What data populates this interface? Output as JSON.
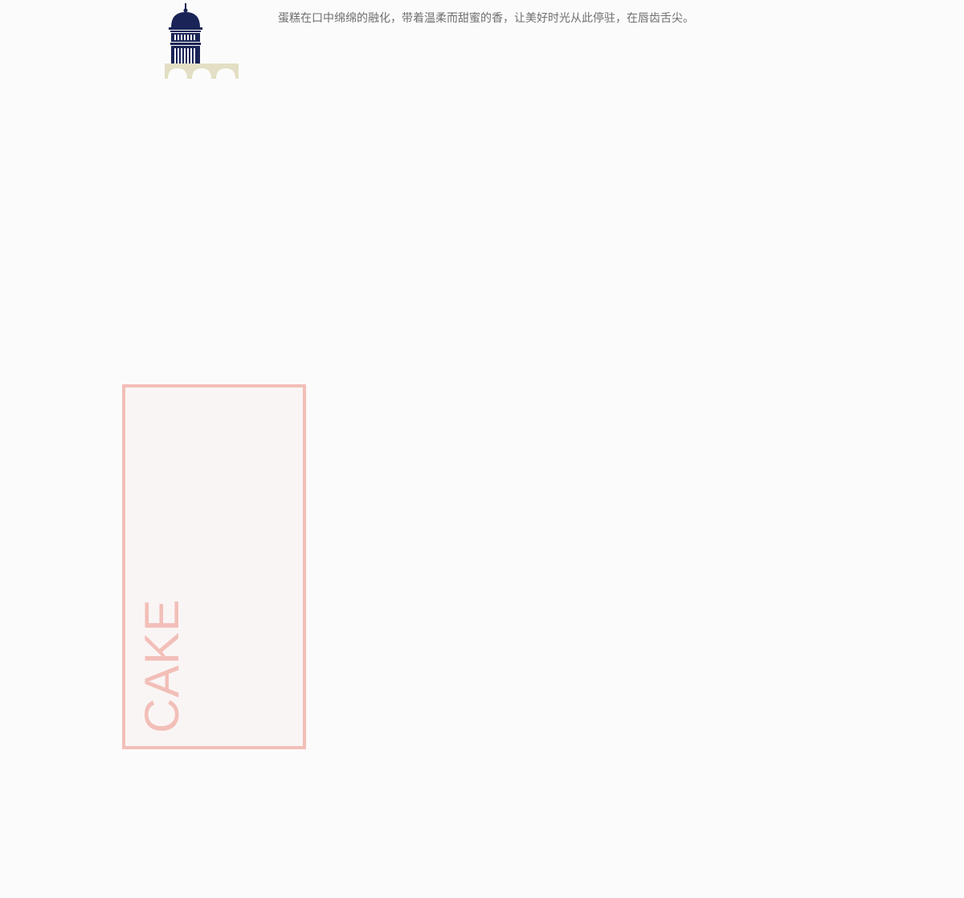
{
  "header": {
    "logo_icon": "capitol-dome-icon",
    "tagline": "蛋糕在口中绵绵的融化，带着温柔而甜蜜的香，让美好时光从此停驻，在唇齿舌尖。"
  },
  "feature": {
    "label": "CAKE"
  },
  "colors": {
    "background": "#fcfbfb",
    "navy": "#1a2456",
    "beige": "#e3dfc4",
    "pink": "#f2bfb8",
    "text": "#6f6f6f"
  }
}
